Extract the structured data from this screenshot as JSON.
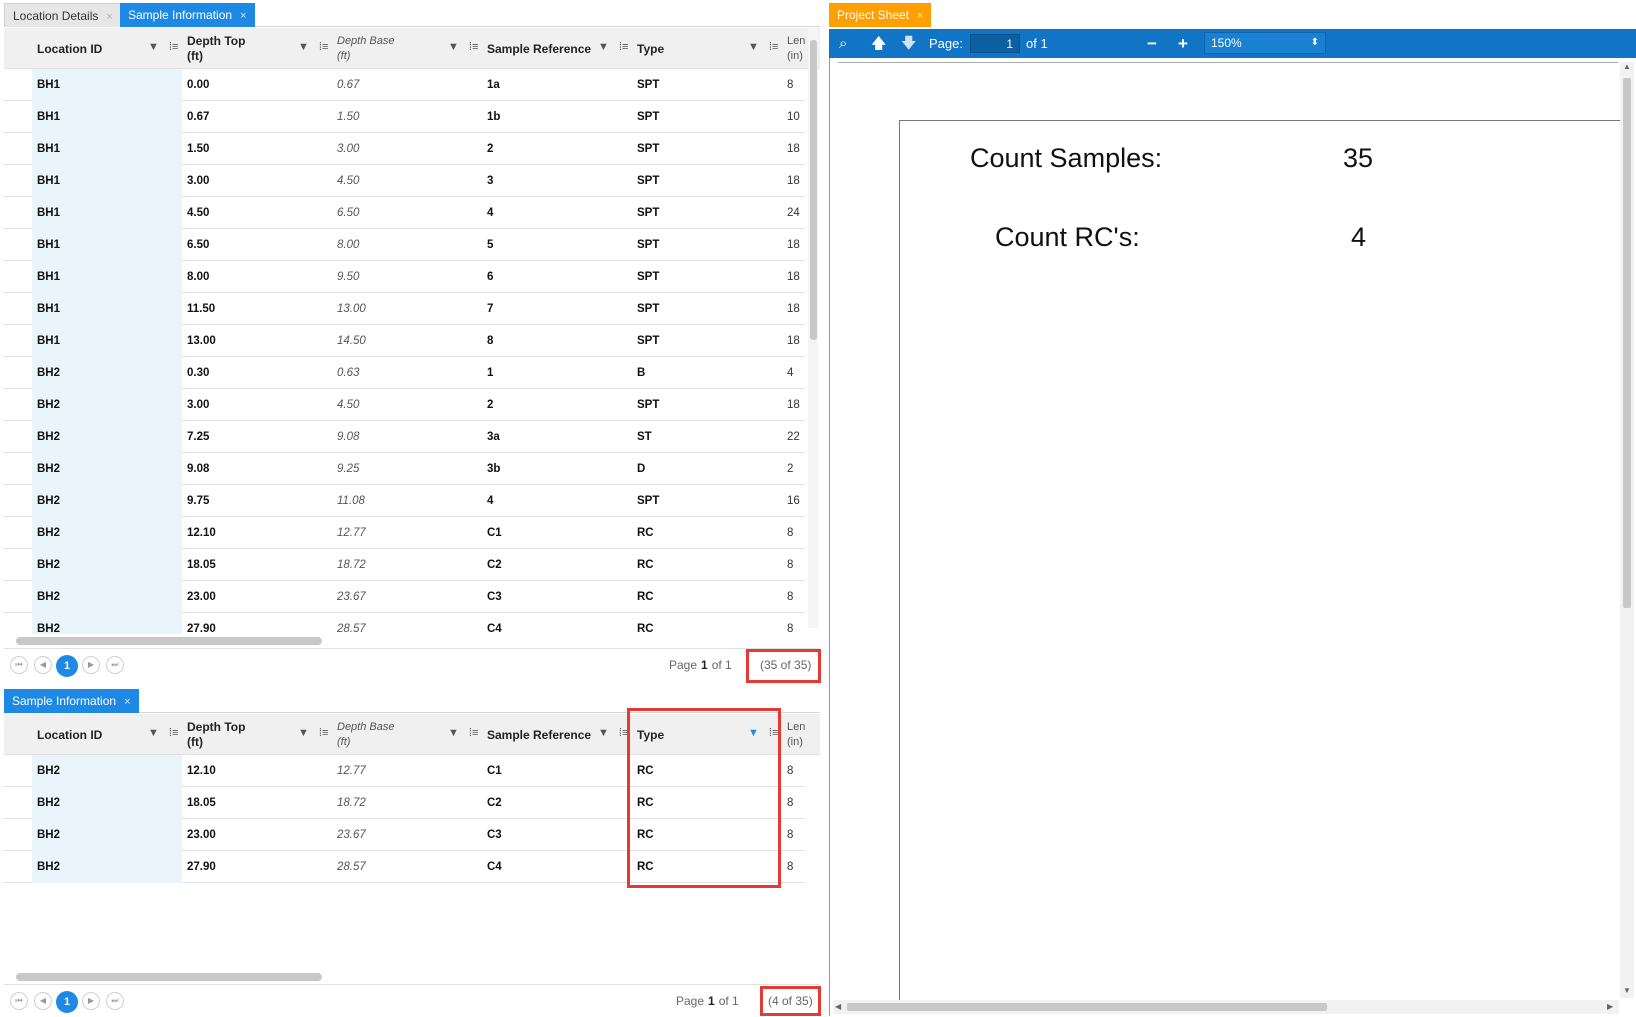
{
  "tabs_top": {
    "location_details": "Location Details",
    "sample_information": "Sample Information",
    "close": "×"
  },
  "tabs_bottom": {
    "sample_information": "Sample Information",
    "close": "×"
  },
  "columns": {
    "location_id": "Location ID",
    "depth_top_1": "Depth Top",
    "depth_top_2": "(ft)",
    "depth_base_1": "Depth Base",
    "depth_base_2": "(ft)",
    "sample_reference": "Sample Reference",
    "type": "Type",
    "length_1": "Len",
    "length_2": "(in)"
  },
  "top_rows": [
    [
      "BH1",
      "0.00",
      "0.67",
      "1a",
      "SPT",
      "8"
    ],
    [
      "BH1",
      "0.67",
      "1.50",
      "1b",
      "SPT",
      "10"
    ],
    [
      "BH1",
      "1.50",
      "3.00",
      "2",
      "SPT",
      "18"
    ],
    [
      "BH1",
      "3.00",
      "4.50",
      "3",
      "SPT",
      "18"
    ],
    [
      "BH1",
      "4.50",
      "6.50",
      "4",
      "SPT",
      "24"
    ],
    [
      "BH1",
      "6.50",
      "8.00",
      "5",
      "SPT",
      "18"
    ],
    [
      "BH1",
      "8.00",
      "9.50",
      "6",
      "SPT",
      "18"
    ],
    [
      "BH1",
      "11.50",
      "13.00",
      "7",
      "SPT",
      "18"
    ],
    [
      "BH1",
      "13.00",
      "14.50",
      "8",
      "SPT",
      "18"
    ],
    [
      "BH2",
      "0.30",
      "0.63",
      "1",
      "B",
      "4"
    ],
    [
      "BH2",
      "3.00",
      "4.50",
      "2",
      "SPT",
      "18"
    ],
    [
      "BH2",
      "7.25",
      "9.08",
      "3a",
      "ST",
      "22"
    ],
    [
      "BH2",
      "9.08",
      "9.25",
      "3b",
      "D",
      "2"
    ],
    [
      "BH2",
      "9.75",
      "11.08",
      "4",
      "SPT",
      "16"
    ],
    [
      "BH2",
      "12.10",
      "12.77",
      "C1",
      "RC",
      "8"
    ],
    [
      "BH2",
      "18.05",
      "18.72",
      "C2",
      "RC",
      "8"
    ],
    [
      "BH2",
      "23.00",
      "23.67",
      "C3",
      "RC",
      "8"
    ],
    [
      "BH2",
      "27.90",
      "28.57",
      "C4",
      "RC",
      "8"
    ]
  ],
  "bottom_rows": [
    [
      "BH2",
      "12.10",
      "12.77",
      "C1",
      "RC",
      "8"
    ],
    [
      "BH2",
      "18.05",
      "18.72",
      "C2",
      "RC",
      "8"
    ],
    [
      "BH2",
      "23.00",
      "23.67",
      "C3",
      "RC",
      "8"
    ],
    [
      "BH2",
      "27.90",
      "28.57",
      "C4",
      "RC",
      "8"
    ]
  ],
  "pager_top": {
    "page_label": "Page",
    "page": "1",
    "of_label": "of 1",
    "count": "(35 of 35)",
    "current_button": "1"
  },
  "pager_bottom": {
    "page_label": "Page",
    "page": "1",
    "of_label": "of 1",
    "count": "(4 of 35)",
    "current_button": "1"
  },
  "viewer": {
    "tab": "Project Sheet",
    "close": "×",
    "page_label": "Page:",
    "page_value": "1",
    "of_label": "of 1",
    "minus": "−",
    "plus": "+",
    "zoom": "150%",
    "count_samples_label": "Count Samples:",
    "count_samples_value": "35",
    "count_rc_label": "Count RC's:",
    "count_rc_value": "4"
  },
  "colors": {
    "accent_blue": "#1e88e5",
    "toolbar_blue": "#1274c5",
    "tab_orange": "#ffa000",
    "highlight_red": "#e53935",
    "stripe": "#eaf4fb"
  }
}
